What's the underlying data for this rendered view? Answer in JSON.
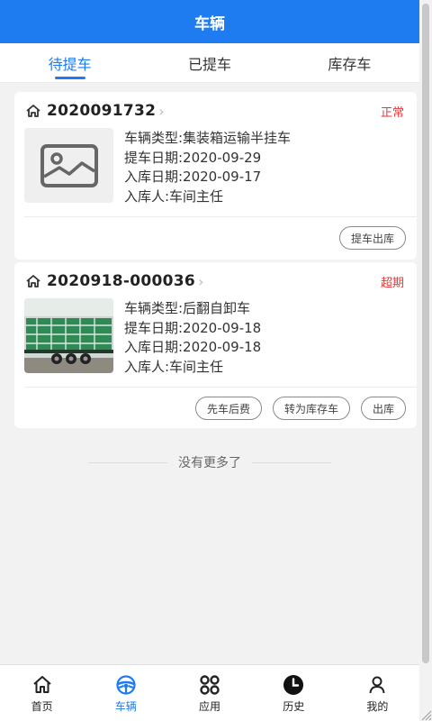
{
  "header": {
    "title": "车辆"
  },
  "tabs": [
    {
      "label": "待提车",
      "active": true
    },
    {
      "label": "已提车",
      "active": false
    },
    {
      "label": "库存车",
      "active": false
    }
  ],
  "cards": [
    {
      "id": "2020091732",
      "status": "正常",
      "image": "placeholder-image",
      "fields": [
        "车辆类型:集装箱运输半挂车",
        "提车日期:2020-09-29",
        "入库日期:2020-09-17",
        "入库人:车间主任"
      ],
      "actions": [
        "提车出库"
      ]
    },
    {
      "id": "2020918-000036",
      "status": "超期",
      "image": "truck-photo",
      "fields": [
        "车辆类型:后翻自卸车",
        "提车日期:2020-09-18",
        "入库日期:2020-09-18",
        "入库人:车间主任"
      ],
      "actions": [
        "先车后费",
        "转为库存车",
        "出库"
      ]
    }
  ],
  "footer_note": "没有更多了",
  "tabbar": [
    {
      "label": "首页",
      "icon": "home-icon",
      "active": false
    },
    {
      "label": "车辆",
      "icon": "steering-wheel-icon",
      "active": true
    },
    {
      "label": "应用",
      "icon": "apps-grid-icon",
      "active": false
    },
    {
      "label": "历史",
      "icon": "clock-icon",
      "active": false
    },
    {
      "label": "我的",
      "icon": "user-icon",
      "active": false
    }
  ],
  "colors": {
    "primary": "#1e7cf0",
    "status_red": "#e23a3a"
  }
}
